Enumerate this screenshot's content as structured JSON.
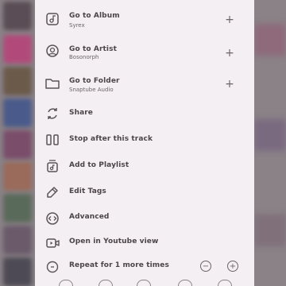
{
  "menu": {
    "go_to_album": {
      "label": "Go to Album",
      "sub": "Syrex"
    },
    "go_to_artist": {
      "label": "Go to Artist",
      "sub": "Bosonorph"
    },
    "go_to_folder": {
      "label": "Go to Folder",
      "sub": "Snaptube Audio"
    },
    "share": {
      "label": "Share"
    },
    "stop_after": {
      "label": "Stop after this track"
    },
    "add_playlist": {
      "label": "Add to Playlist"
    },
    "edit_tags": {
      "label": "Edit Tags"
    },
    "advanced": {
      "label": "Advanced"
    },
    "open_youtube": {
      "label": "Open in Youtube view"
    },
    "repeat": {
      "label": "Repeat for 1 more times"
    }
  },
  "colors": {
    "sheet_bg": "#f4eff2",
    "text": "#4b4448",
    "subtext": "#6c6468",
    "backdrop": "#8a8287"
  },
  "icons": {
    "album": "album-icon",
    "artist": "artist-icon",
    "folder": "folder-icon",
    "share": "share-icon",
    "stop": "pause-stop-icon",
    "playlist": "playlist-add-icon",
    "tags": "edit-tag-icon",
    "advanced": "code-icon",
    "youtube": "video-icon",
    "repeat": "repeat-icon"
  }
}
